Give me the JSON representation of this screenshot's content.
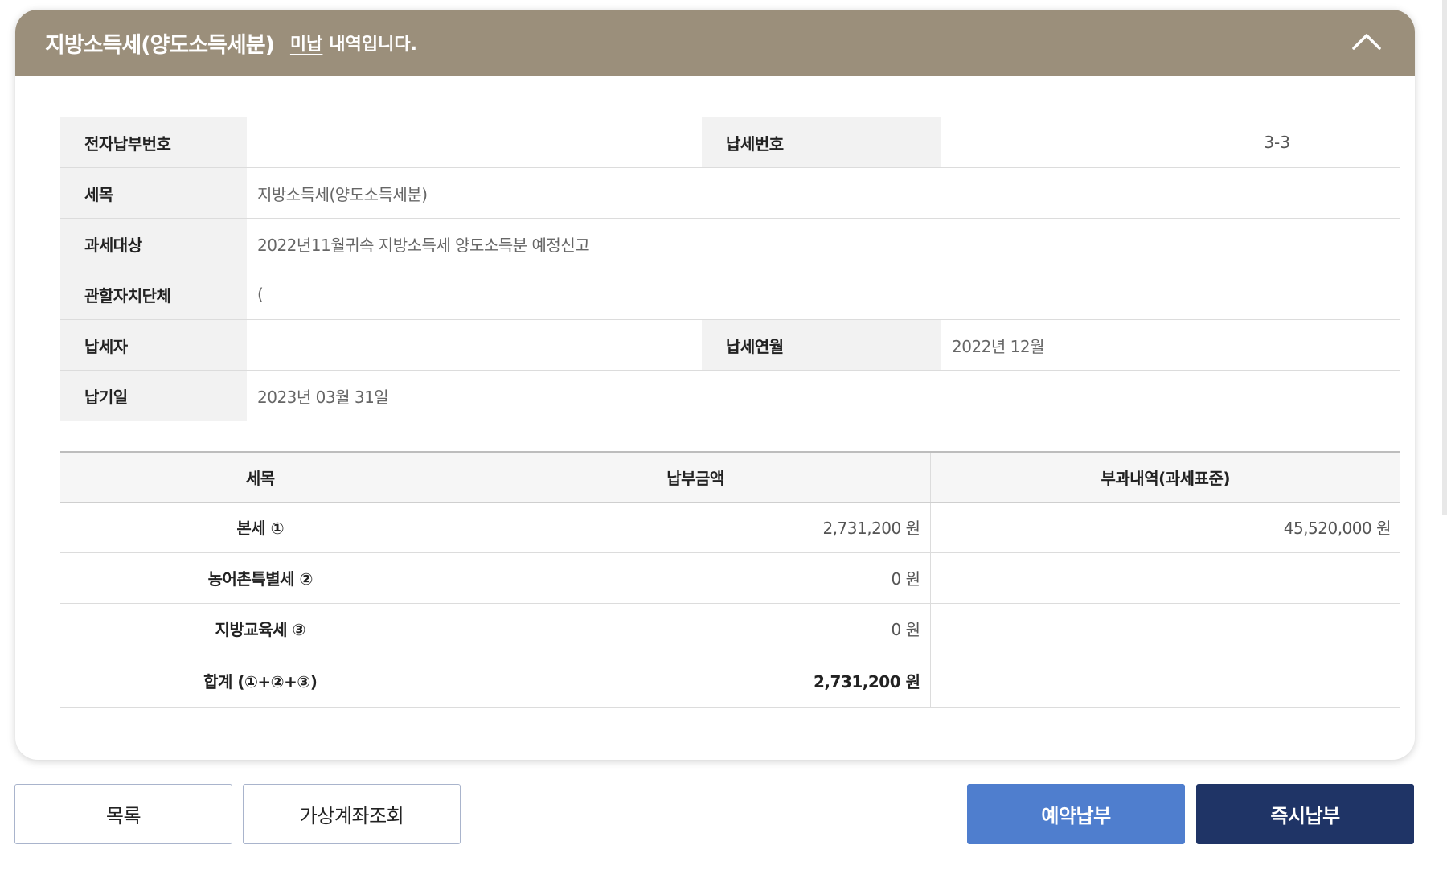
{
  "header": {
    "title": "지방소득세(양도소득세분)",
    "status": "미납",
    "suffix": "내역입니다."
  },
  "info": {
    "electronic_payment_no_label": "전자납부번호",
    "electronic_payment_no_value": "",
    "tax_no_label": "납세번호",
    "tax_no_value": "3-3",
    "tax_item_label": "세목",
    "tax_item_value": "지방소득세(양도소득세분)",
    "tax_target_label": "과세대상",
    "tax_target_value": "2022년11월귀속 지방소득세 양도소득분 예정신고",
    "authority_label": "관할자치단체",
    "authority_value": "(",
    "taxpayer_label": "납세자",
    "taxpayer_value": "",
    "tax_month_label": "납세연월",
    "tax_month_value": "2022년 12월",
    "due_date_label": "납기일",
    "due_date_value": "2023년 03월 31일"
  },
  "amounts": {
    "headers": [
      "세목",
      "납부금액",
      "부과내역(과세표준)"
    ],
    "rows": [
      {
        "name": "본세 ①",
        "amount": "2,731,200 원",
        "base": "45,520,000 원"
      },
      {
        "name": "농어촌특별세 ②",
        "amount": "0 원",
        "base": ""
      },
      {
        "name": "지방교육세 ③",
        "amount": "0 원",
        "base": ""
      },
      {
        "name": "합계 (①+②+③)",
        "amount": "2,731,200 원",
        "base": ""
      }
    ]
  },
  "buttons": {
    "list": "목록",
    "virtual_account": "가상계좌조회",
    "scheduled_payment": "예약납부",
    "instant_payment": "즉시납부"
  },
  "colors": {
    "header_bg": "#9b8f7b",
    "scheduled_btn": "#4f7ece",
    "instant_btn": "#1f3466"
  },
  "icons": {
    "collapse": "chevron-up-icon"
  }
}
